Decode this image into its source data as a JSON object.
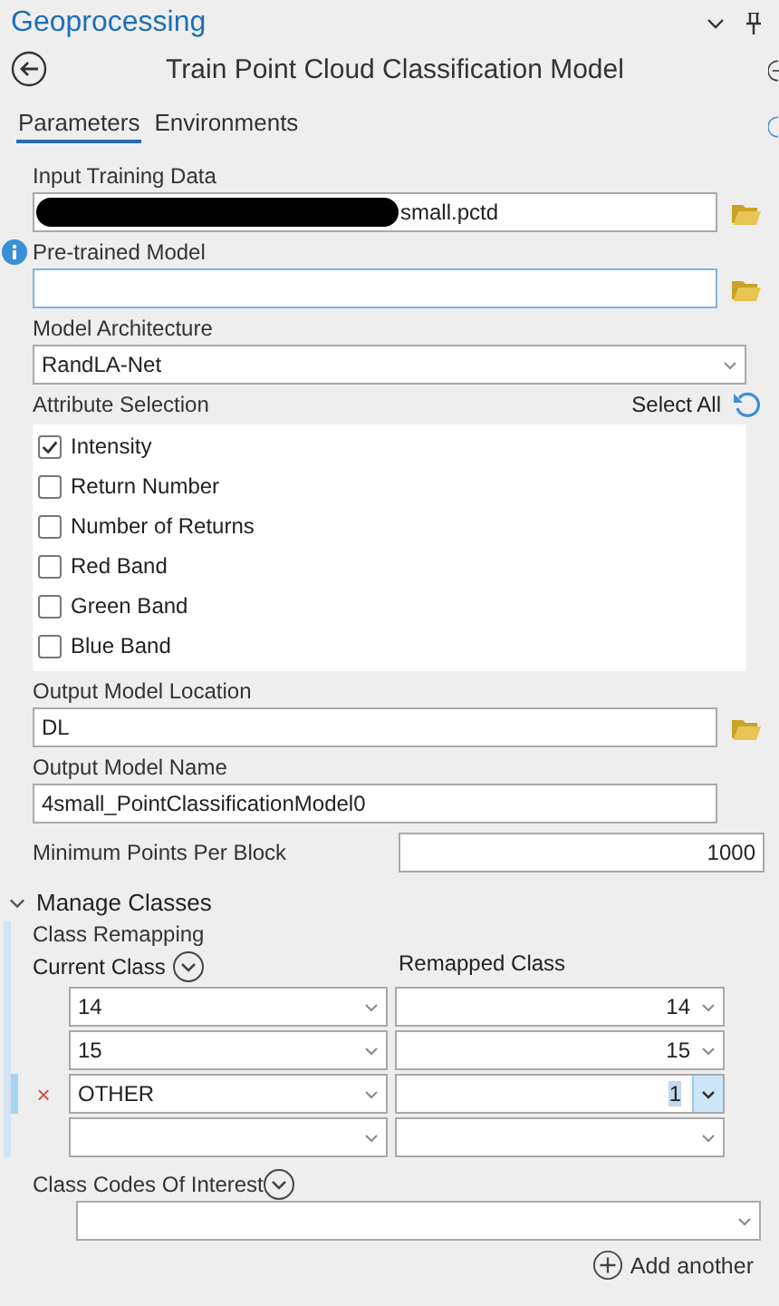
{
  "pane": {
    "title": "Geoprocessing"
  },
  "tool": {
    "title": "Train Point Cloud Classification Model"
  },
  "tabs": [
    {
      "label": "Parameters",
      "selected": true
    },
    {
      "label": "Environments",
      "selected": false
    }
  ],
  "parameters": [
    {
      "kind": "file",
      "label": "Input Training Data",
      "value": "small.pctd",
      "redacted": true,
      "info": false
    },
    {
      "kind": "file",
      "label": "Pre-trained Model",
      "info": true
    },
    {
      "kind": "select",
      "label": "Model Architecture",
      "value": "RandLA-Net"
    }
  ],
  "attribute_selection": {
    "label": "Attribute Selection",
    "select_all": "Select All",
    "items": [
      {
        "label": "Intensity",
        "checked": true
      },
      {
        "label": "Return Number",
        "checked": false
      },
      {
        "label": "Number of Returns",
        "checked": false
      },
      {
        "label": "Red Band",
        "checked": false
      },
      {
        "label": "Green Band",
        "checked": false
      },
      {
        "label": "Blue Band",
        "checked": false
      }
    ]
  },
  "outputs": [
    {
      "kind": "file",
      "label": "Output Model Location",
      "value": "DL"
    },
    {
      "kind": "text",
      "label": "Output Model Name",
      "value": "4small_PointClassificationModel0"
    },
    {
      "kind": "inline-number",
      "label": "Minimum Points Per Block",
      "value": "1000"
    }
  ],
  "manage_classes": {
    "title": "Manage Classes",
    "expanded": true,
    "class_remapping": "Class Remapping",
    "current_class": "Current Class",
    "remapped_class": "Remapped Class",
    "rows": [
      {
        "current": "14",
        "remapped": "14",
        "selected": false
      },
      {
        "current": "15",
        "remapped": "15",
        "selected": false
      },
      {
        "current": "OTHER",
        "remapped": "1",
        "selected": true,
        "delete": "×"
      },
      {
        "selected": false
      }
    ],
    "class_codes_label": "Class Codes Of Interest",
    "add_another": "Add another"
  }
}
